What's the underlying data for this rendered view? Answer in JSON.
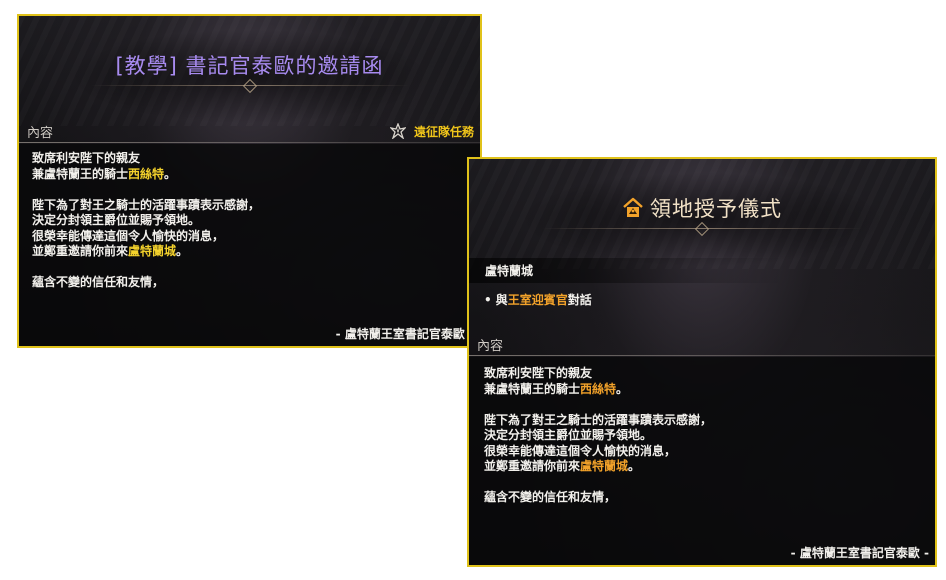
{
  "panel_tutorial": {
    "title": "[教學] 書記官泰歐的邀請函",
    "section_label": "內容",
    "quest_type": "遠征隊任務",
    "letter": {
      "line1": "致席利安陛下的親友",
      "line2_prefix": "兼盧特蘭王的騎士",
      "line2_highlight": "西絲特",
      "line2_suffix": "。",
      "line3": "陛下為了對王之騎士的活躍事蹟表示感謝，",
      "line4": "決定分封領主爵位並賜予領地。",
      "line5": "很榮幸能傳達這個令人愉快的消息，",
      "line6_prefix": "並鄭重邀請你前來",
      "line6_highlight": "盧特蘭城",
      "line6_suffix": "。",
      "line7": "蘊含不變的信任和友情，"
    },
    "signature": "- 盧特蘭王室書記官泰歐 -"
  },
  "panel_ceremony": {
    "title": "領地授予儀式",
    "location": "盧特蘭城",
    "objective_prefix": "與",
    "objective_highlight": "王室迎賓官",
    "objective_suffix": "對話",
    "section_label": "內容",
    "letter": {
      "line1": "致席利安陛下的親友",
      "line2_prefix": "兼盧特蘭王的騎士",
      "line2_highlight": "西絲特",
      "line2_suffix": "。",
      "line3": "陛下為了對王之騎士的活躍事蹟表示感謝，",
      "line4": "決定分封領主爵位並賜予領地。",
      "line5": "很榮幸能傳達這個令人愉快的消息，",
      "line6_prefix": "並鄭重邀請你前來",
      "line6_highlight": "盧特蘭城",
      "line6_suffix": "。",
      "line7": "蘊含不變的信任和友情，"
    },
    "signature": "- 盧特蘭王室書記官泰歐 -"
  },
  "colors": {
    "border": "#e0c21a",
    "tutorial_title": "#a88bf0",
    "highlight_yellow": "#f4d22c",
    "highlight_orange": "#f2a22a",
    "quest_type": "#f0c51a"
  },
  "icons": {
    "quest_type_icon": "expedition-emblem-icon",
    "ceremony_title_icon": "territory-house-icon"
  }
}
